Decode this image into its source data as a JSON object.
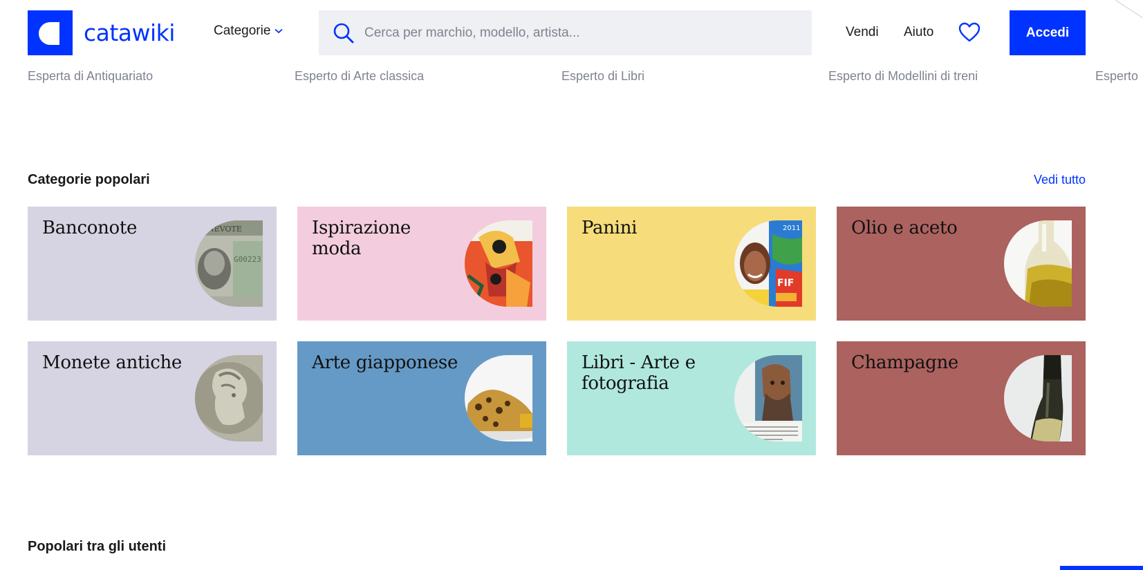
{
  "brand": {
    "name": "catawiki",
    "accent": "#0033ff"
  },
  "header": {
    "categories_label": "Categorie",
    "search_placeholder": "Cerca per marchio, modello, artista...",
    "sell_label": "Vendi",
    "help_label": "Aiuto",
    "login_label": "Accedi"
  },
  "experts": [
    "Esperta di Antiquariato",
    "Esperto di Arte classica",
    "Esperto di Libri",
    "Esperto di Modellini di treni",
    "Esperto"
  ],
  "popular_categories": {
    "title": "Categorie popolari",
    "see_all": "Vedi tutto",
    "items": [
      {
        "label": "Banconote",
        "color": "#d6d3e3"
      },
      {
        "label": "Ispirazione moda",
        "color": "#f3cddd"
      },
      {
        "label": "Panini",
        "color": "#f6dc7a"
      },
      {
        "label": "Olio e aceto",
        "color": "#ac625f"
      },
      {
        "label": "Monete antiche",
        "color": "#d6d3e3"
      },
      {
        "label": "Arte giapponese",
        "color": "#669ac6"
      },
      {
        "label": "Libri - Arte e fotografia",
        "color": "#b0e8de"
      },
      {
        "label": "Champagne",
        "color": "#ac625f"
      }
    ]
  },
  "popular_users": {
    "title": "Popolari tra gli utenti"
  }
}
